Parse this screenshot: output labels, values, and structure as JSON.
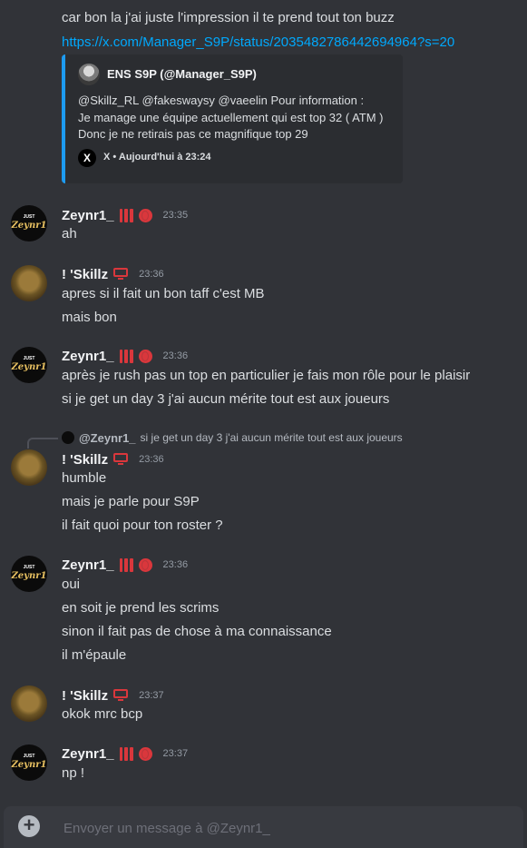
{
  "top_lines": [
    "car bon la j'ai juste l'impression il te prend tout ton buzz",
    "https://x.com/Manager_S9P/status/2035482786442694964?s=20"
  ],
  "embed": {
    "author": "ENS S9P (@Manager_S9P)",
    "lines": [
      "@Skillz_RL @fakeswaysy @vaeelin Pour information :",
      "Je manage une équipe actuellement qui est top 32 ( ATM )",
      "Donc je ne retirais pas ce magnifique top 29"
    ],
    "footer_icon": "X",
    "footer": "X • Aujourd'hui à 23:24"
  },
  "avatar_text": {
    "just": "JUST",
    "name": "Zeynr1"
  },
  "messages": [
    {
      "user": "Zeynr1_",
      "time": "23:35",
      "lines": [
        "ah"
      ]
    },
    {
      "user": "! 'Skillz",
      "time": "23:36",
      "lines": [
        "apres si il fait un bon taff c'est MB",
        "mais bon"
      ]
    },
    {
      "user": "Zeynr1_",
      "time": "23:36",
      "lines": [
        "après je rush pas un top en particulier je fais mon rôle pour le plaisir",
        "si je get un day 3 j'ai aucun mérite tout est aux joueurs"
      ]
    },
    {
      "user": "! 'Skillz",
      "time": "23:36",
      "lines": [
        "humble",
        "mais je parle pour S9P",
        "il fait quoi pour ton roster ?"
      ]
    },
    {
      "user": "Zeynr1_",
      "time": "23:36",
      "lines": [
        "oui",
        "en soit je prend les scrims",
        "sinon il fait pas de chose à ma connaissance",
        "il m'épaule"
      ]
    },
    {
      "user": "! 'Skillz",
      "time": "23:37",
      "lines": [
        "okok mrc bcp"
      ]
    },
    {
      "user": "Zeynr1_",
      "time": "23:37",
      "lines": [
        "np !"
      ]
    }
  ],
  "reply": {
    "user": "@Zeynr1_",
    "text": "si je get un day 3 j'ai aucun mérite tout est aux joueurs"
  },
  "composer": {
    "placeholder": "Envoyer un message à @Zeynr1_",
    "plus": "+"
  }
}
